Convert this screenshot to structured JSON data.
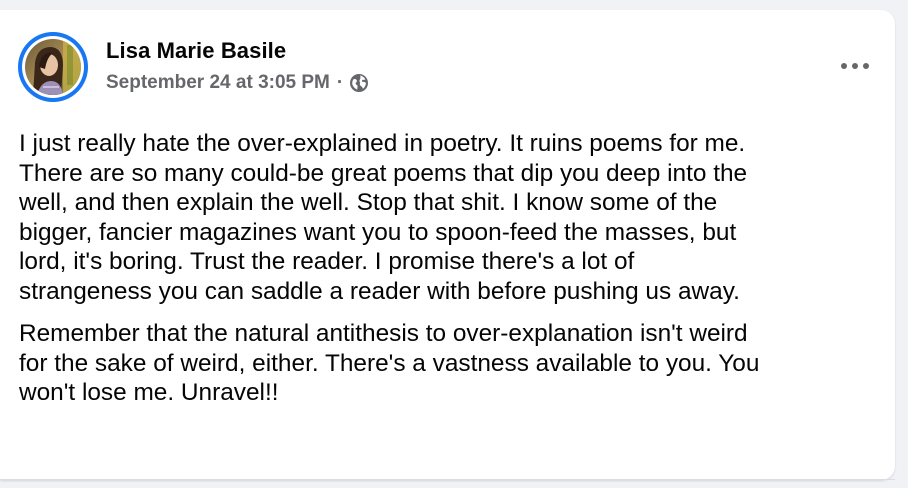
{
  "post": {
    "author": {
      "name": "Lisa Marie Basile",
      "avatar_icon": "profile-photo"
    },
    "timestamp": "September 24 at 3:05 PM",
    "separator": "·",
    "privacy_icon": "globe-icon",
    "more_icon": "more-horizontal-icon",
    "paragraphs": [
      "I just really hate the over-explained in poetry. It ruins poems for me.\nThere are so many could-be great poems that dip you deep into the\nwell, and then explain the well. Stop that shit. I know some of the\nbigger, fancier magazines want you to spoon-feed the masses, but\nlord, it's boring. Trust the reader. I promise there's a lot of\nstrangeness you can saddle a reader with before pushing us away.",
      "Remember that the natural antithesis to over-explanation isn't weird\nfor the sake of weird, either. There's a vastness available to you. You\nwon't lose me. Unravel!!"
    ]
  },
  "colors": {
    "page_background": "#f0f2f5",
    "card_background": "#ffffff",
    "primary_text": "#050505",
    "secondary_text": "#65676b",
    "story_ring": "#1877f2"
  }
}
